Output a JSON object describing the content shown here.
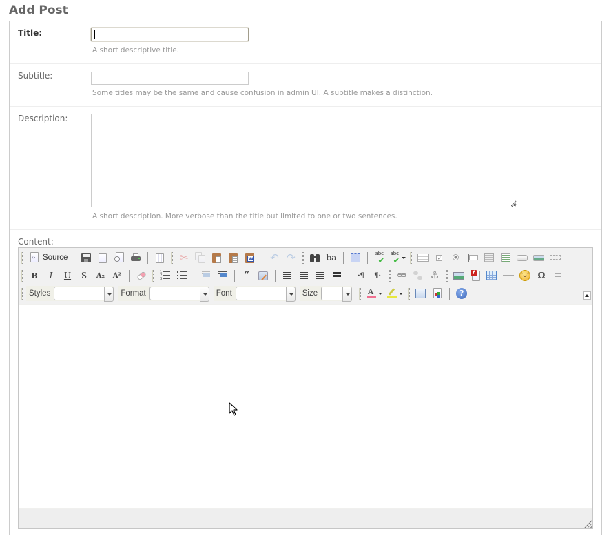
{
  "page": {
    "title": "Add Post"
  },
  "form": {
    "title": {
      "label": "Title:",
      "value": "",
      "help": "A short descriptive title."
    },
    "subtitle": {
      "label": "Subtitle:",
      "value": "",
      "help": "Some titles may be the same and cause confusion in admin UI. A subtitle makes a distinction."
    },
    "description": {
      "label": "Description:",
      "value": "",
      "help": "A short description. More verbose than the title but limited to one or two sentences."
    },
    "content": {
      "label": "Content:",
      "value": ""
    }
  },
  "editor": {
    "toolbar": {
      "source_label": "Source",
      "row1": [
        "source-icon",
        "save-icon",
        "new-page-icon",
        "preview-icon",
        "print-icon",
        "templates-icon",
        "cut-icon",
        "copy-icon",
        "paste-icon",
        "paste-text-icon",
        "paste-word-icon",
        "undo-icon",
        "redo-icon",
        "find-icon",
        "replace-icon",
        "select-all-icon",
        "spellcheck-icon",
        "spellcheck-as-you-type-icon",
        "form-icon",
        "checkbox-icon",
        "radio-icon",
        "text-field-icon",
        "textarea-icon",
        "select-field-icon",
        "button-icon",
        "image-button-icon",
        "hidden-field-icon"
      ],
      "row2": [
        "bold-icon",
        "italic-icon",
        "underline-icon",
        "strikethrough-icon",
        "subscript-icon",
        "superscript-icon",
        "remove-format-icon",
        "numbered-list-icon",
        "bulleted-list-icon",
        "outdent-icon",
        "indent-icon",
        "blockquote-icon",
        "create-div-icon",
        "align-left-icon",
        "align-center-icon",
        "align-right-icon",
        "justify-icon",
        "ltr-icon",
        "rtl-icon",
        "link-icon",
        "unlink-icon",
        "anchor-icon",
        "image-icon",
        "flash-icon",
        "table-icon",
        "horizontal-rule-icon",
        "smiley-icon",
        "special-char-icon",
        "page-break-icon"
      ],
      "row3": {
        "styles_label": "Styles",
        "styles_value": "",
        "format_label": "Format",
        "format_value": "",
        "font_label": "Font",
        "font_value": "",
        "size_label": "Size",
        "size_value": "",
        "icons": [
          "text-color-icon",
          "background-color-icon",
          "maximize-icon",
          "show-blocks-icon",
          "about-icon"
        ]
      },
      "glyphs": {
        "bold": "B",
        "italic": "I",
        "underline": "U",
        "strike": "S",
        "subscript": "A₂",
        "superscript": "A²",
        "blockquote": "“",
        "ltr": "·¶",
        "rtl": "¶·",
        "omega": "Ω",
        "find_replace": "ba",
        "abc": "abc",
        "text_color": "A",
        "about": "?"
      }
    }
  },
  "colors": {
    "heading": "#666666",
    "help_text": "#999999",
    "text_color_bar": "#f07090",
    "highlight_bar": "#e8e840",
    "about_blue": "#4a78c8"
  }
}
